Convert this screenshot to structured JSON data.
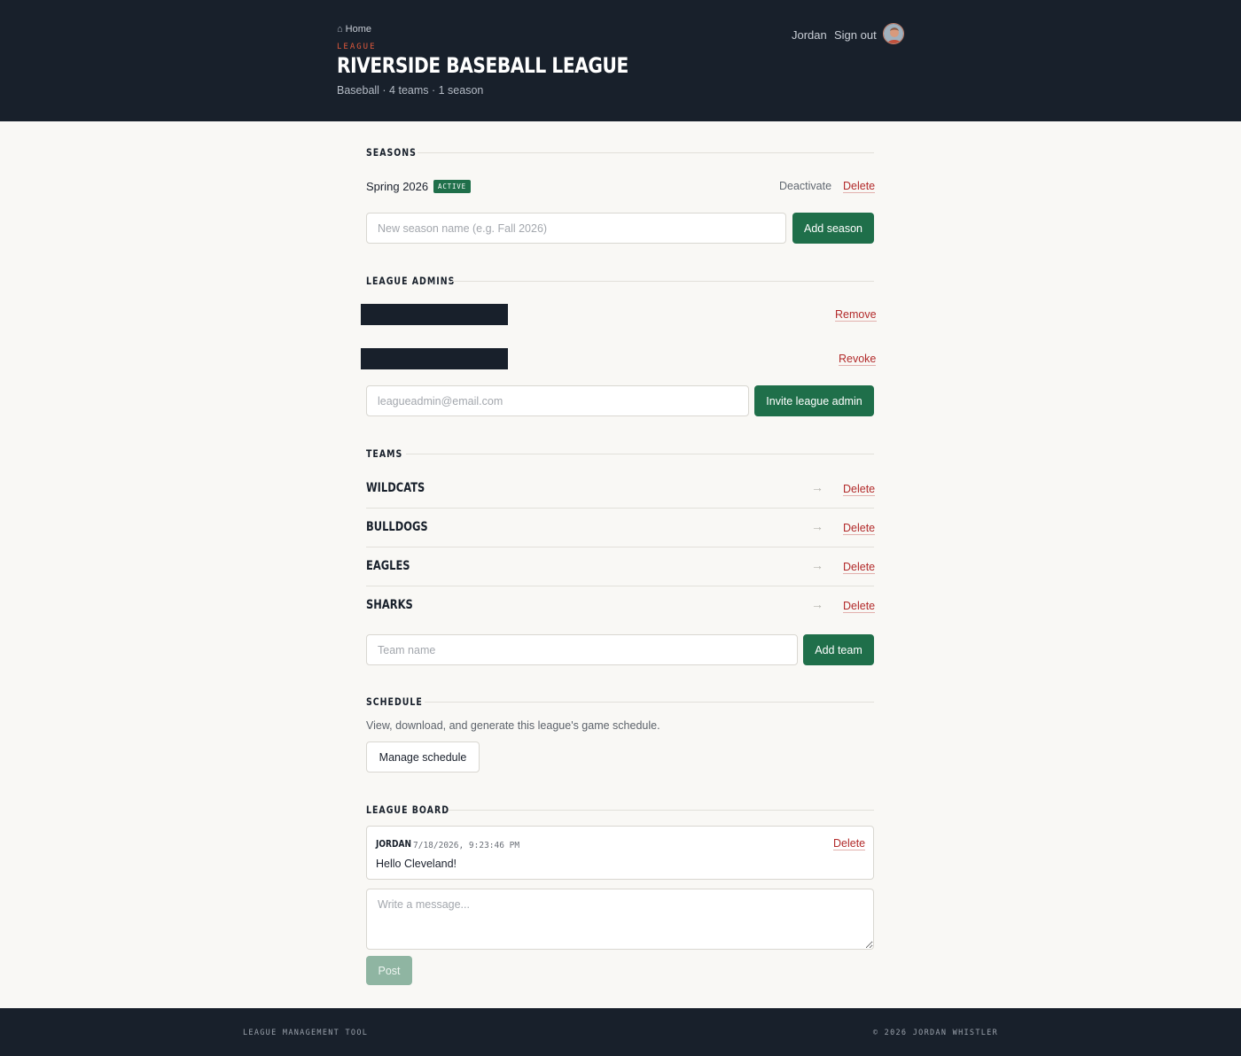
{
  "header": {
    "home_label": "Home",
    "home_icon": "home-icon",
    "eyebrow": "LEAGUE",
    "title": "RIVERSIDE BASEBALL LEAGUE",
    "meta": "Baseball · 4 teams · 1 season",
    "user_name": "Jordan",
    "signout_label": "Sign out"
  },
  "seasons": {
    "heading": "SEASONS",
    "items": [
      {
        "name": "Spring 2026",
        "badge": "ACTIVE",
        "deactivate_label": "Deactivate",
        "delete_label": "Delete"
      }
    ],
    "input_placeholder": "New season name (e.g. Fall 2026)",
    "input_value": "",
    "add_label": "Add season"
  },
  "admins": {
    "heading": "LEAGUE ADMINS",
    "rows": [
      {
        "action_label": "Remove"
      },
      {
        "action_label": "Revoke"
      }
    ],
    "input_placeholder": "leagueadmin@email.com",
    "input_value": "",
    "invite_label": "Invite league admin"
  },
  "teams": {
    "heading": "TEAMS",
    "items": [
      {
        "name": "WILDCATS",
        "arrow": "→",
        "delete_label": "Delete"
      },
      {
        "name": "BULLDOGS",
        "arrow": "→",
        "delete_label": "Delete"
      },
      {
        "name": "EAGLES",
        "arrow": "→",
        "delete_label": "Delete"
      },
      {
        "name": "SHARKS",
        "arrow": "→",
        "delete_label": "Delete"
      }
    ],
    "input_placeholder": "Team name",
    "input_value": "",
    "add_label": "Add team"
  },
  "schedule": {
    "heading": "SCHEDULE",
    "description": "View, download, and generate this league's game schedule.",
    "manage_label": "Manage schedule"
  },
  "board": {
    "heading": "LEAGUE BOARD",
    "messages": [
      {
        "author": "JORDAN",
        "timestamp": "7/18/2026, 9:23:46 PM",
        "body": "Hello Cleveland!",
        "delete_label": "Delete"
      }
    ],
    "textarea_placeholder": "Write a message...",
    "post_label": "Post"
  },
  "footer": {
    "left": "LEAGUE MANAGEMENT TOOL",
    "right": "© 2026 JORDAN WHISTLER"
  },
  "colors": {
    "header_bg": "#18202b",
    "page_bg": "#f9f8f5",
    "accent_green": "#1f6f4a",
    "danger_red": "#b22a2a",
    "eyebrow_orange": "#e0593c"
  }
}
